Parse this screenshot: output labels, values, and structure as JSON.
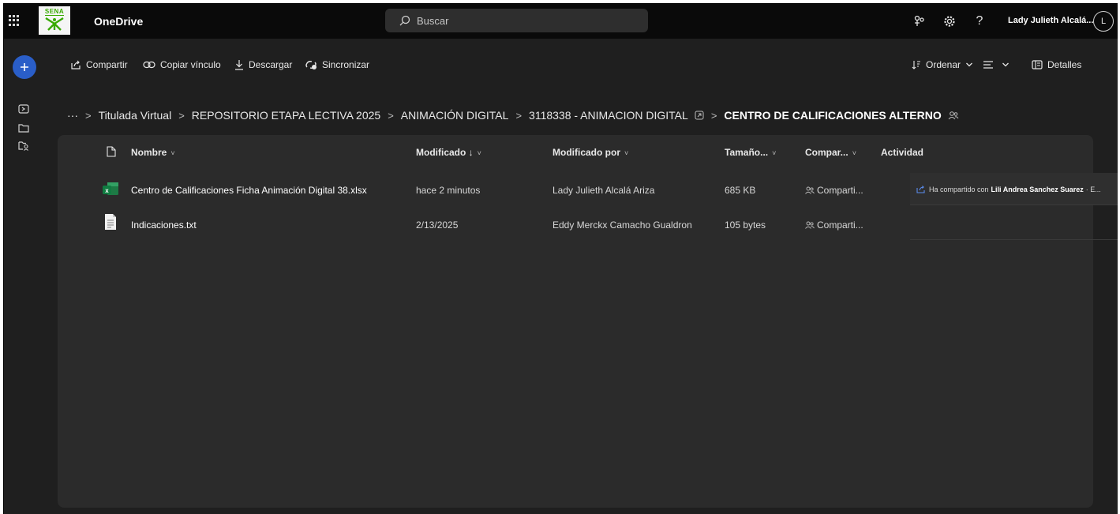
{
  "topbar": {
    "logo_text": "SENA",
    "app_title": "OneDrive",
    "search_placeholder": "Buscar",
    "user_name": "Lady Julieth Alcalá...",
    "avatar_initial": "L",
    "icons": [
      "waffle-icon",
      "search-icon",
      "share-network-icon",
      "gear-icon",
      "help-icon"
    ]
  },
  "rail": {
    "new_button_icon": "plus-icon",
    "items": [
      "home-icon",
      "folder-icon",
      "shared-folder-icon"
    ]
  },
  "commands": {
    "share": "Compartir",
    "copy_link": "Copiar vínculo",
    "download": "Descargar",
    "sync": "Sincronizar",
    "sort": "Ordenar",
    "details": "Detalles"
  },
  "breadcrumb": {
    "overflow": "···",
    "items": [
      "Titulada Virtual",
      "REPOSITORIO ETAPA LECTIVA 2025",
      "ANIMACIÓN DIGITAL",
      "3118338 - ANIMACION DIGITAL"
    ],
    "current": "CENTRO DE CALIFICACIONES ALTERNO"
  },
  "columns": {
    "name": "Nombre",
    "modified": "Modificado ↓",
    "modified_by": "Modificado por",
    "size": "Tamaño...",
    "sharing": "Compar...",
    "activity": "Actividad"
  },
  "files": [
    {
      "name": "Centro de Calificaciones Ficha Animación Digital 38.xlsx",
      "type": "excel-file-icon",
      "modified": "hace 2 minutos",
      "modified_by": "Lady Julieth Alcalá Ariza",
      "size": "685 KB",
      "sharing": "Comparti...",
      "activity_prefix": "Ha compartido con",
      "activity_person": "Lili Andrea Sanchez Suarez",
      "activity_suffix": "· E..."
    },
    {
      "name": "Indicaciones.txt",
      "type": "text-file-icon",
      "modified": "2/13/2025",
      "modified_by": "Eddy Merckx Camacho Gualdron",
      "size": "105 bytes",
      "sharing": "Comparti..."
    }
  ],
  "colors": {
    "background": "#1f1f1f",
    "topbar": "#0a0a0a",
    "panel": "#2b2b2b",
    "accent_blue": "#2a5ec8",
    "excel_green": "#1d7a45",
    "sena_green": "#38aa00"
  }
}
